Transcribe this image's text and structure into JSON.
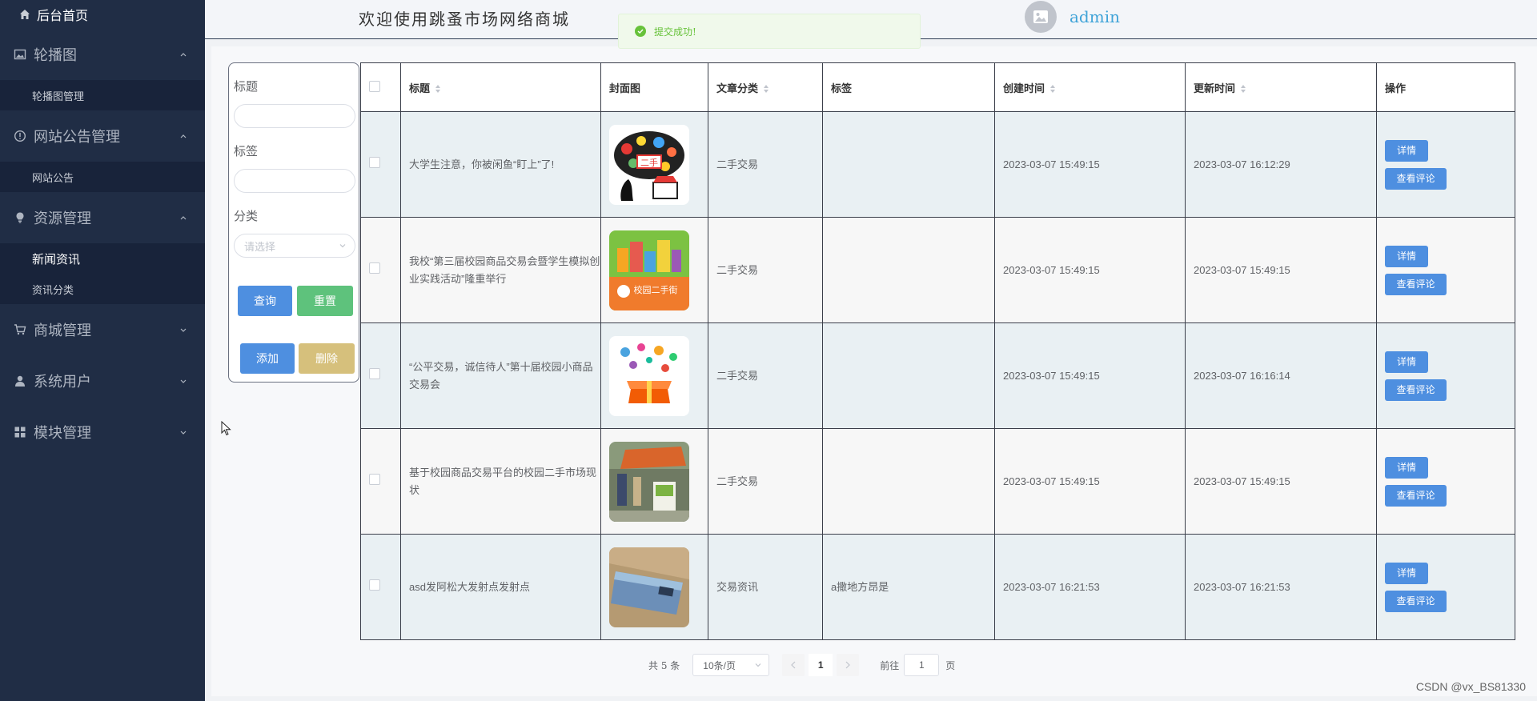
{
  "sidebar": {
    "home": "后台首页",
    "groups": [
      {
        "label": "轮播图",
        "icon": "image-icon",
        "expanded": true,
        "items": [
          {
            "label": "轮播图管理",
            "active": false
          }
        ]
      },
      {
        "label": "网站公告管理",
        "icon": "info-circle-icon",
        "expanded": true,
        "items": [
          {
            "label": "网站公告",
            "active": false
          }
        ]
      },
      {
        "label": "资源管理",
        "icon": "bulb-icon",
        "expanded": true,
        "items": [
          {
            "label": "新闻资讯",
            "active": true
          },
          {
            "label": "资讯分类",
            "active": false
          }
        ]
      },
      {
        "label": "商城管理",
        "icon": "cart-icon",
        "expanded": false,
        "items": []
      },
      {
        "label": "系统用户",
        "icon": "user-icon",
        "expanded": false,
        "items": []
      },
      {
        "label": "模块管理",
        "icon": "grid-icon",
        "expanded": false,
        "items": []
      }
    ]
  },
  "header": {
    "welcome": "欢迎使用跳蚤市场网络商城",
    "username": "admin",
    "toast": "提交成功!"
  },
  "search": {
    "title_label": "标题",
    "tag_label": "标签",
    "category_label": "分类",
    "category_placeholder": "请选择",
    "query_button": "查询",
    "reset_button": "重置",
    "add_button": "添加",
    "delete_button": "删除"
  },
  "table": {
    "columns": [
      "标题",
      "封面图",
      "文章分类",
      "标签",
      "创建时间",
      "更新时间",
      "操作"
    ],
    "rows": [
      {
        "title": "大学生注意，你被闲鱼“盯上”了!",
        "category": "二手交易",
        "tag": "",
        "created": "2023-03-07 15:49:15",
        "updated": "2023-03-07 16:12:29",
        "cover_icon": "secondhand-marketplace-cover-icon"
      },
      {
        "title": "我校“第三届校园商品交易会暨学生模拟创业实践活动”隆重举行",
        "category": "二手交易",
        "tag": "",
        "created": "2023-03-07 15:49:15",
        "updated": "2023-03-07 15:49:15",
        "cover_icon": "campus-secondhand-cover-icon",
        "cover_text": "校园二手街"
      },
      {
        "title": "“公平交易，诚信待人”第十届校园小商品交易会",
        "category": "二手交易",
        "tag": "",
        "created": "2023-03-07 15:49:15",
        "updated": "2023-03-07 16:16:14",
        "cover_icon": "gift-box-cover-icon"
      },
      {
        "title": "基于校园商品交易平台的校园二手市场现状",
        "category": "二手交易",
        "tag": "",
        "created": "2023-03-07 15:49:15",
        "updated": "2023-03-07 15:49:15",
        "cover_icon": "outdoor-market-cover-icon"
      },
      {
        "title": "asd发阿松大发射点发射点",
        "category": "交易资讯",
        "tag": "a撒地方昂是",
        "created": "2023-03-07 16:21:53",
        "updated": "2023-03-07 16:21:53",
        "cover_icon": "phone-photo-cover-icon"
      }
    ],
    "detail_button": "详情",
    "comment_button": "查看评论"
  },
  "pagination": {
    "total": "共 5 条",
    "page_size": "10条/页",
    "current_page": "1",
    "goto_label": "前往",
    "goto_value": "1",
    "page_unit": "页"
  },
  "watermark": "CSDN @vx_BS81330",
  "colors": {
    "sidebar_bg": "#202d45",
    "primary": "#4e8fe0",
    "success": "#5ec27c",
    "warning": "#d6c07c",
    "link": "#3fa3d8"
  }
}
